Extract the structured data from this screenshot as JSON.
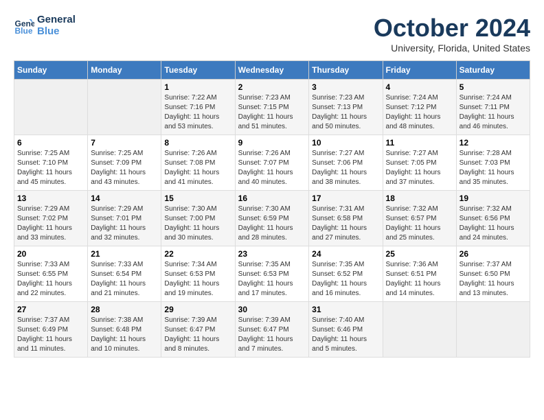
{
  "header": {
    "logo_line1": "General",
    "logo_line2": "Blue",
    "month_title": "October 2024",
    "subtitle": "University, Florida, United States"
  },
  "days_of_week": [
    "Sunday",
    "Monday",
    "Tuesday",
    "Wednesday",
    "Thursday",
    "Friday",
    "Saturday"
  ],
  "weeks": [
    [
      {
        "day": "",
        "empty": true
      },
      {
        "day": "",
        "empty": true
      },
      {
        "day": "1",
        "sunrise": "7:22 AM",
        "sunset": "7:16 PM",
        "daylight": "11 hours and 53 minutes."
      },
      {
        "day": "2",
        "sunrise": "7:23 AM",
        "sunset": "7:15 PM",
        "daylight": "11 hours and 51 minutes."
      },
      {
        "day": "3",
        "sunrise": "7:23 AM",
        "sunset": "7:13 PM",
        "daylight": "11 hours and 50 minutes."
      },
      {
        "day": "4",
        "sunrise": "7:24 AM",
        "sunset": "7:12 PM",
        "daylight": "11 hours and 48 minutes."
      },
      {
        "day": "5",
        "sunrise": "7:24 AM",
        "sunset": "7:11 PM",
        "daylight": "11 hours and 46 minutes."
      }
    ],
    [
      {
        "day": "6",
        "sunrise": "7:25 AM",
        "sunset": "7:10 PM",
        "daylight": "11 hours and 45 minutes."
      },
      {
        "day": "7",
        "sunrise": "7:25 AM",
        "sunset": "7:09 PM",
        "daylight": "11 hours and 43 minutes."
      },
      {
        "day": "8",
        "sunrise": "7:26 AM",
        "sunset": "7:08 PM",
        "daylight": "11 hours and 41 minutes."
      },
      {
        "day": "9",
        "sunrise": "7:26 AM",
        "sunset": "7:07 PM",
        "daylight": "11 hours and 40 minutes."
      },
      {
        "day": "10",
        "sunrise": "7:27 AM",
        "sunset": "7:06 PM",
        "daylight": "11 hours and 38 minutes."
      },
      {
        "day": "11",
        "sunrise": "7:27 AM",
        "sunset": "7:05 PM",
        "daylight": "11 hours and 37 minutes."
      },
      {
        "day": "12",
        "sunrise": "7:28 AM",
        "sunset": "7:03 PM",
        "daylight": "11 hours and 35 minutes."
      }
    ],
    [
      {
        "day": "13",
        "sunrise": "7:29 AM",
        "sunset": "7:02 PM",
        "daylight": "11 hours and 33 minutes."
      },
      {
        "day": "14",
        "sunrise": "7:29 AM",
        "sunset": "7:01 PM",
        "daylight": "11 hours and 32 minutes."
      },
      {
        "day": "15",
        "sunrise": "7:30 AM",
        "sunset": "7:00 PM",
        "daylight": "11 hours and 30 minutes."
      },
      {
        "day": "16",
        "sunrise": "7:30 AM",
        "sunset": "6:59 PM",
        "daylight": "11 hours and 28 minutes."
      },
      {
        "day": "17",
        "sunrise": "7:31 AM",
        "sunset": "6:58 PM",
        "daylight": "11 hours and 27 minutes."
      },
      {
        "day": "18",
        "sunrise": "7:32 AM",
        "sunset": "6:57 PM",
        "daylight": "11 hours and 25 minutes."
      },
      {
        "day": "19",
        "sunrise": "7:32 AM",
        "sunset": "6:56 PM",
        "daylight": "11 hours and 24 minutes."
      }
    ],
    [
      {
        "day": "20",
        "sunrise": "7:33 AM",
        "sunset": "6:55 PM",
        "daylight": "11 hours and 22 minutes."
      },
      {
        "day": "21",
        "sunrise": "7:33 AM",
        "sunset": "6:54 PM",
        "daylight": "11 hours and 21 minutes."
      },
      {
        "day": "22",
        "sunrise": "7:34 AM",
        "sunset": "6:53 PM",
        "daylight": "11 hours and 19 minutes."
      },
      {
        "day": "23",
        "sunrise": "7:35 AM",
        "sunset": "6:53 PM",
        "daylight": "11 hours and 17 minutes."
      },
      {
        "day": "24",
        "sunrise": "7:35 AM",
        "sunset": "6:52 PM",
        "daylight": "11 hours and 16 minutes."
      },
      {
        "day": "25",
        "sunrise": "7:36 AM",
        "sunset": "6:51 PM",
        "daylight": "11 hours and 14 minutes."
      },
      {
        "day": "26",
        "sunrise": "7:37 AM",
        "sunset": "6:50 PM",
        "daylight": "11 hours and 13 minutes."
      }
    ],
    [
      {
        "day": "27",
        "sunrise": "7:37 AM",
        "sunset": "6:49 PM",
        "daylight": "11 hours and 11 minutes."
      },
      {
        "day": "28",
        "sunrise": "7:38 AM",
        "sunset": "6:48 PM",
        "daylight": "11 hours and 10 minutes."
      },
      {
        "day": "29",
        "sunrise": "7:39 AM",
        "sunset": "6:47 PM",
        "daylight": "11 hours and 8 minutes."
      },
      {
        "day": "30",
        "sunrise": "7:39 AM",
        "sunset": "6:47 PM",
        "daylight": "11 hours and 7 minutes."
      },
      {
        "day": "31",
        "sunrise": "7:40 AM",
        "sunset": "6:46 PM",
        "daylight": "11 hours and 5 minutes."
      },
      {
        "day": "",
        "empty": true
      },
      {
        "day": "",
        "empty": true
      }
    ]
  ]
}
